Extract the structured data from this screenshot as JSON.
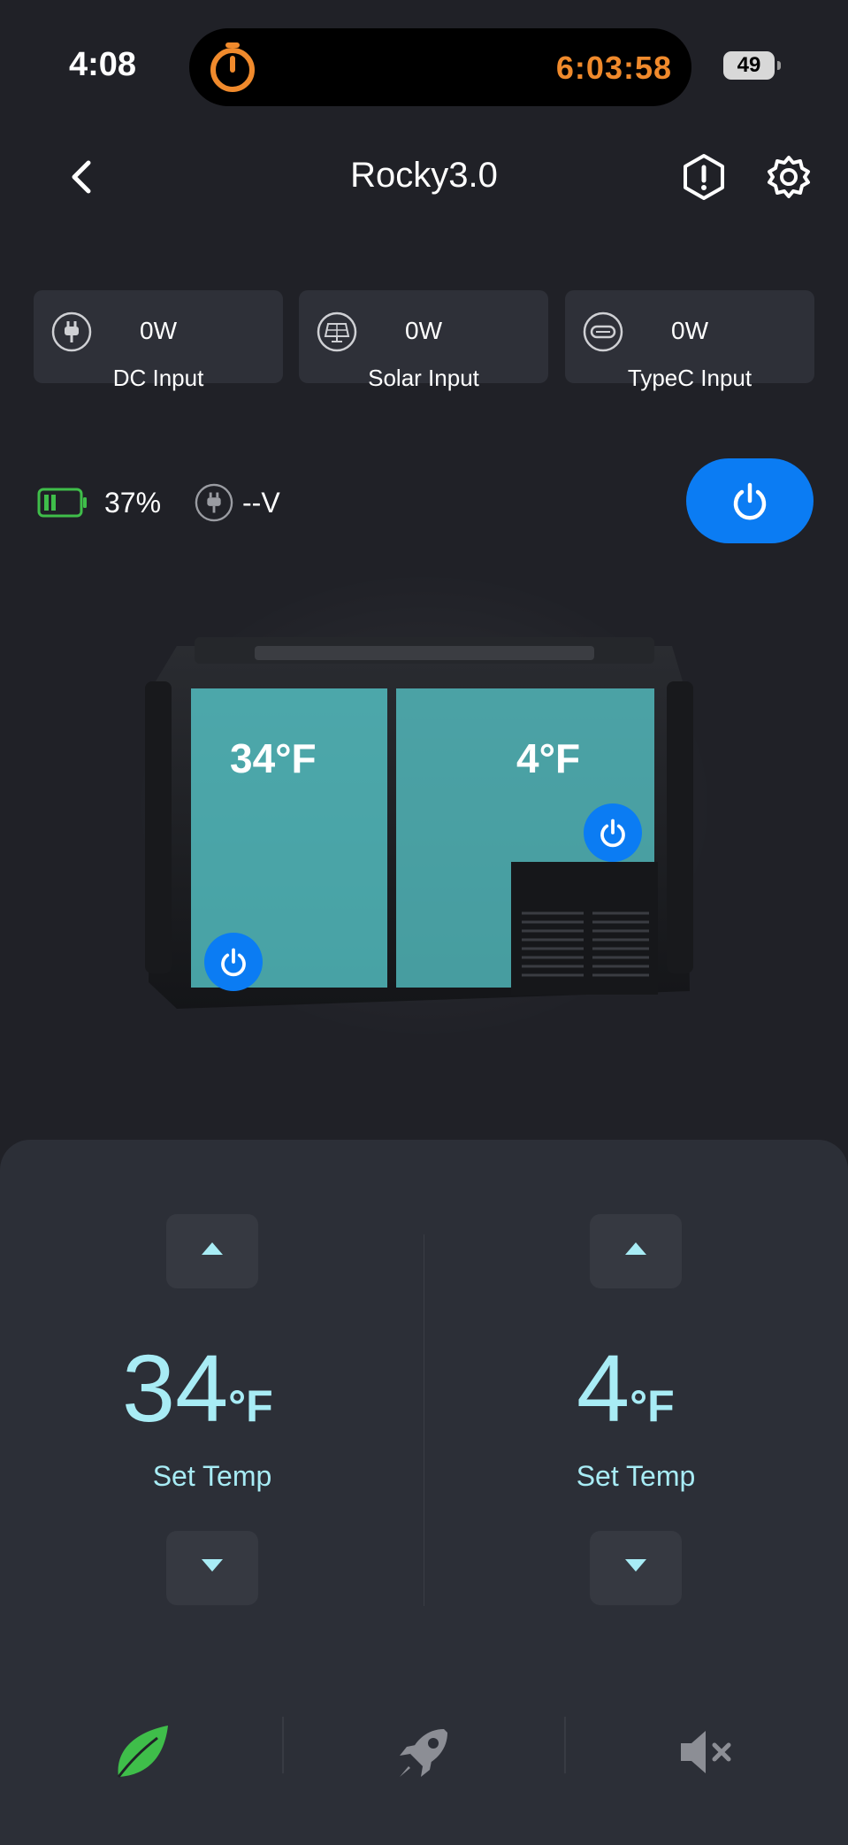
{
  "status_bar": {
    "time": "4:08",
    "timer": "6:03:58",
    "battery": "49"
  },
  "header": {
    "title": "Rocky3.0",
    "back_icon": "chevron-left-icon",
    "alert_icon": "alert-hexagon-icon",
    "settings_icon": "gear-icon"
  },
  "inputs": [
    {
      "icon": "plug-icon",
      "value": "0W",
      "label": "DC Input"
    },
    {
      "icon": "solar-panel-icon",
      "value": "0W",
      "label": "Solar Input"
    },
    {
      "icon": "usb-c-icon",
      "value": "0W",
      "label": "TypeC Input"
    }
  ],
  "status_row": {
    "battery_percent": "37%",
    "battery_level": 0.37,
    "voltage": "--V"
  },
  "fridge": {
    "left_zone": {
      "temp": "34°F"
    },
    "right_zone": {
      "temp": "4°F"
    }
  },
  "controls": {
    "left": {
      "value": "34",
      "unit": "°F",
      "label": "Set Temp"
    },
    "right": {
      "value": "4",
      "unit": "°F",
      "label": "Set Temp"
    }
  },
  "tab_bar": [
    {
      "icon": "leaf-icon",
      "active": true
    },
    {
      "icon": "rocket-icon",
      "active": false
    },
    {
      "icon": "speaker-mute-icon",
      "active": false
    }
  ],
  "colors": {
    "background": "#202127",
    "accent": "#0b7cf3",
    "temperature": "#a8ecf5",
    "timer": "#f08a2c",
    "eco": "#3fbe4a"
  }
}
